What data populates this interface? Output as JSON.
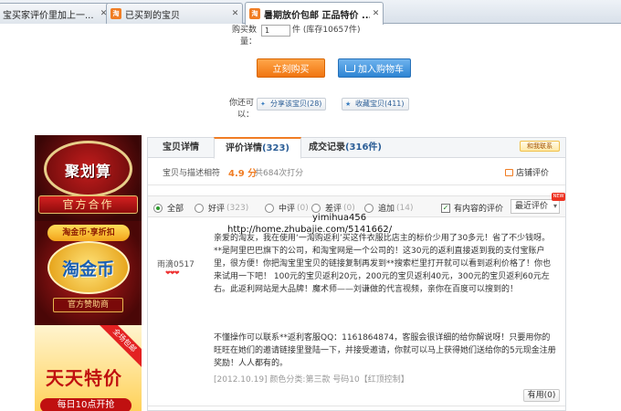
{
  "browser": {
    "tabs": [
      {
        "label": "宝买家评价里加上一...",
        "close": "✕",
        "icon": ""
      },
      {
        "label": "已买到的宝贝",
        "close": "✕",
        "icon": "淘"
      },
      {
        "label": "暑期放价包邮 正品特价 ...",
        "close": "✕",
        "icon": "淘"
      }
    ]
  },
  "purchase": {
    "qty_label": "购买数量：",
    "qty_value": "1",
    "qty_unit": "件 (库存10657件)",
    "buy_now": "立刻购买",
    "add_cart": "加入购物车",
    "share_label": "你还可以：",
    "share_item": "分享该宝贝(28)",
    "favorite_item": "收藏宝贝(411)"
  },
  "ads": {
    "ad1_title": "聚划算",
    "ad1_ribbon": "官方合作",
    "ad2_tag": "淘金币·享折扣",
    "ad2_title": "淘金币",
    "ad2_sub": "官方赞助商",
    "ad3_corner": "全场包邮",
    "ad3_title": "天天特价",
    "ad3_sub": "每日10点开抢"
  },
  "reviews": {
    "tabs": {
      "details": "宝贝详情",
      "reviews_label": "评价详情",
      "reviews_count": "(323)",
      "deals_label": "成交记录",
      "deals_count": "(316件)"
    },
    "contact": "和我联系",
    "rating_label": "宝贝与描述相符",
    "rating_score": "4.9 分",
    "rating_count": "共684次打分",
    "shop_rating": "店铺评价",
    "filters": [
      {
        "label": "全部",
        "count": ""
      },
      {
        "label": "好评",
        "count": "(323)"
      },
      {
        "label": "中评",
        "count": "(0)"
      },
      {
        "label": "差评",
        "count": "(0)"
      },
      {
        "label": "追加",
        "count": "(14)"
      }
    ],
    "content_only": "有内容的评价",
    "sort": "最近评价",
    "new_badge": "NEW",
    "watermark1": "yimihua456",
    "watermark2": "http://home.zhubajie.com/5141662/",
    "reviewer": "雨滴0517",
    "reviewer_level": "❤❤❤",
    "review_text": "亲爱的淘友，我在使用‘一淘购返利’买这件衣服比店主的标价少用了30多元！省了不少钱呀。**是阿里巴巴旗下的公司，和淘宝网是一个公司的！这30元的返利直接返到我的支付宝账户里，很方便！你把淘宝里宝贝的链接复制再发到**搜索栏里打开就可以看到返利价格了！你也来试用一下吧！ 100元的宝贝返利20元，200元的宝贝返利40元，300元的宝贝返利60元左右。此返利网站是大品牌！魔术师——刘谦做的代言视频，亲你在百度可以搜到的！",
    "review_text2": "不懂操作可以联系**返利客服QQ：1161864874，客服会很详细的给你解说呀！只要用你的旺旺在她们的邀请链接里登陆一下，并接受邀请，你就可以马上获得她们送给你的5元现金注册奖励！人人都有的。",
    "review_meta": "[2012.10.19]  颜色分类:第三款  号码10【红顶控制】",
    "useful": "有用(0)"
  }
}
